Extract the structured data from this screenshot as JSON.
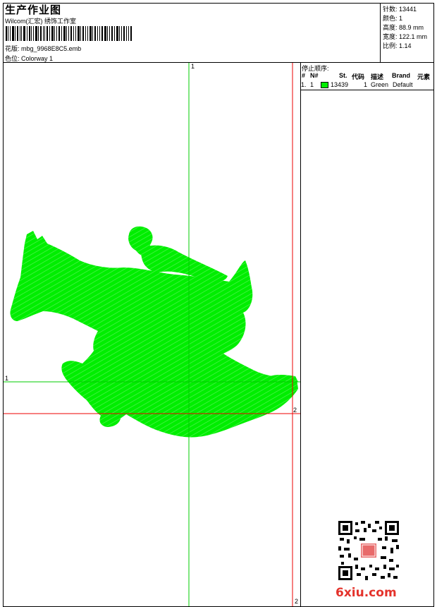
{
  "header": {
    "title": "生产作业图",
    "subtitle": "Wilcom(汇宏) 绣饰工作室",
    "design_file_label": "花版:",
    "design_file": "mbg_9968E8C5.emb",
    "colorway_label": "色位:",
    "colorway": "Colorway 1"
  },
  "stats": [
    {
      "label": "针数:",
      "value": "13441"
    },
    {
      "label": "颜色:",
      "value": "1"
    },
    {
      "label": "高度:",
      "value": "88.9 mm"
    },
    {
      "label": "宽度:",
      "value": "122.1 mm"
    },
    {
      "label": "比例:",
      "value": "1.14"
    }
  ],
  "stop_sequence": {
    "title": "停止顺序:",
    "headers": {
      "idx": "#",
      "no": "N#",
      "st": "St.",
      "code": "代码",
      "desc": "描述",
      "brand": "Brand",
      "element": "元素"
    },
    "rows": [
      {
        "idx": "1.",
        "no": "1",
        "color": "#00ee00",
        "st": "13439",
        "code": "1",
        "desc": "Green",
        "brand": "Default"
      }
    ]
  },
  "guides": {
    "top_marker": "1",
    "left_marker": "1",
    "right_marker": "2",
    "bottom_marker": "2"
  },
  "colors": {
    "stitch": "#00ee00",
    "guide_green": "#00cc00",
    "guide_red": "#ee0000"
  },
  "watermark": "6xiu.com"
}
